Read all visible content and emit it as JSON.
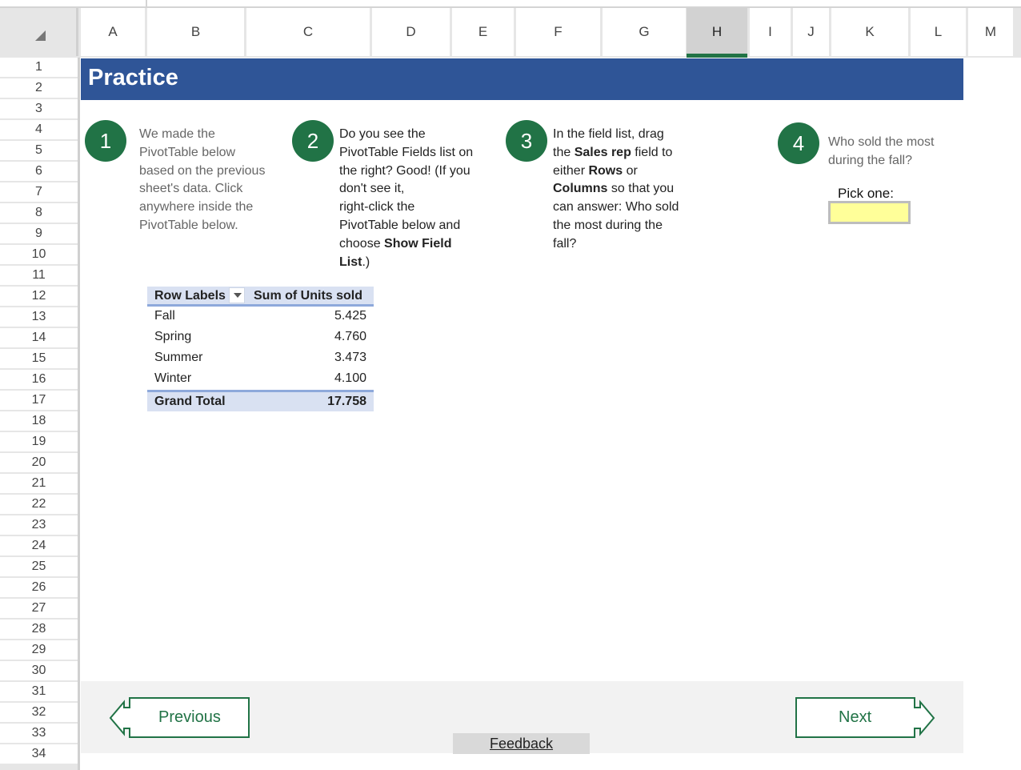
{
  "grid": {
    "columns": [
      "A",
      "B",
      "C",
      "D",
      "E",
      "F",
      "G",
      "H",
      "I",
      "J",
      "K",
      "L",
      "M"
    ],
    "selected_column": "H",
    "rows": [
      "1",
      "2",
      "3",
      "4",
      "5",
      "6",
      "7",
      "8",
      "9",
      "10",
      "11",
      "12",
      "13",
      "14",
      "15",
      "16",
      "17",
      "18",
      "19",
      "20",
      "21",
      "22",
      "23",
      "24",
      "25",
      "26",
      "27",
      "28",
      "29",
      "30",
      "31",
      "32",
      "33",
      "34"
    ]
  },
  "banner": {
    "title": "Practice"
  },
  "steps": [
    {
      "number": "1",
      "text_lines": [
        "We made the",
        "PivotTable below",
        "based on the previous",
        "sheet's data. Click",
        "anywhere inside the",
        "PivotTable below."
      ]
    },
    {
      "number": "2",
      "text": {
        "l1": "Do you see the",
        "l2": "PivotTable Fields list on",
        "l3": "the right? Good! (If you",
        "l4": "don't see it,",
        "l5": "right-click the",
        "l6": "PivotTable below and",
        "l7a": "choose ",
        "l7b": "Show Field",
        "l8a": "List",
        "l8b": ".)"
      }
    },
    {
      "number": "3",
      "text": {
        "l1": "In the field list, drag",
        "l2a": "the ",
        "l2b": "Sales rep",
        "l2c": " field to",
        "l3a": "either ",
        "l3b": "Rows",
        "l3c": " or",
        "l4a": "Columns",
        "l4b": " so that you",
        "l5": "can answer: Who sold",
        "l6": "the most during the",
        "l7": "fall?"
      }
    },
    {
      "number": "4",
      "text_lines": [
        "Who sold the most",
        "during the fall?"
      ]
    }
  ],
  "pick": {
    "label": "Pick one:",
    "value": ""
  },
  "pivot": {
    "header": [
      "Row Labels",
      "Sum of Units sold"
    ],
    "rows": [
      {
        "label": "Fall",
        "value": "5.425"
      },
      {
        "label": "Spring",
        "value": "4.760"
      },
      {
        "label": "Summer",
        "value": "3.473"
      },
      {
        "label": "Winter",
        "value": "4.100"
      }
    ],
    "total": {
      "label": "Grand Total",
      "value": "17.758"
    }
  },
  "nav": {
    "previous": "Previous",
    "next": "Next",
    "feedback": "Feedback"
  },
  "colors": {
    "banner": "#2f5597",
    "accent": "#217346",
    "pivot_header": "#d9e1f2",
    "pick_fill": "#ffff99"
  }
}
